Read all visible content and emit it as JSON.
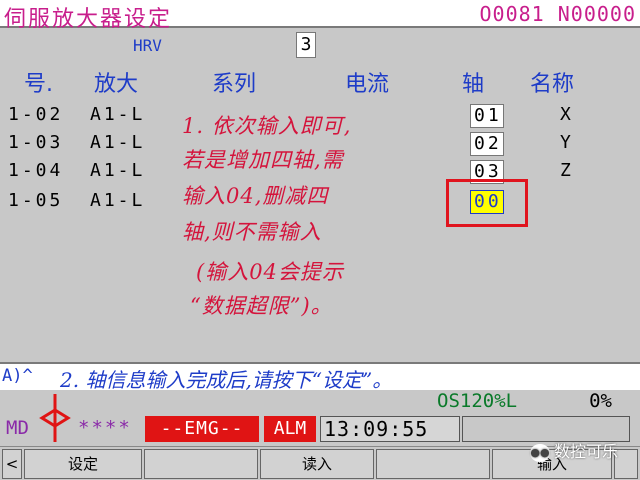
{
  "header": {
    "title": "伺服放大器设定",
    "program": "O0081 N00000"
  },
  "hrv": {
    "label": "HRV",
    "value": "3"
  },
  "columns": {
    "no": "号.",
    "amp": "放大",
    "series": "系列",
    "current": "电流",
    "axis": "轴",
    "name": "名称"
  },
  "rows": [
    {
      "no": "1-02",
      "amp": "A1-L",
      "axis": "01",
      "name": "X"
    },
    {
      "no": "1-03",
      "amp": "A1-L",
      "axis": "02",
      "name": "Y"
    },
    {
      "no": "1-04",
      "amp": "A1-L",
      "axis": "03",
      "name": "Z"
    },
    {
      "no": "1-05",
      "amp": "A1-L",
      "axis": "00",
      "name": ""
    }
  ],
  "annotation": {
    "line1": "1. 依次输入即可,",
    "line2": "若是增加四轴,需",
    "line3": "输入04,删减四",
    "line4": "轴,则不需输入",
    "line5": "(输入04会提示",
    "line6": "“数据超限”)。",
    "line7": "2. 轴信息输入完成后,请按下“设定”。"
  },
  "input": {
    "prompt": "A)^"
  },
  "status": {
    "override": "OS120%L",
    "percent": "0%"
  },
  "mode": {
    "md": "MD",
    "stars": "****",
    "emg": "--EMG--",
    "alm": "ALM",
    "time": "13:09:55"
  },
  "softkeys": {
    "left": "<",
    "k1": "设定",
    "k3": "读入",
    "k5": "输入"
  },
  "watermark": {
    "text": "数控可乐"
  },
  "colors": {
    "accent_red": "#e01414",
    "label_blue": "#1e3cc8",
    "title_magenta": "#c81e8c",
    "highlight_yellow": "#ffff00"
  }
}
